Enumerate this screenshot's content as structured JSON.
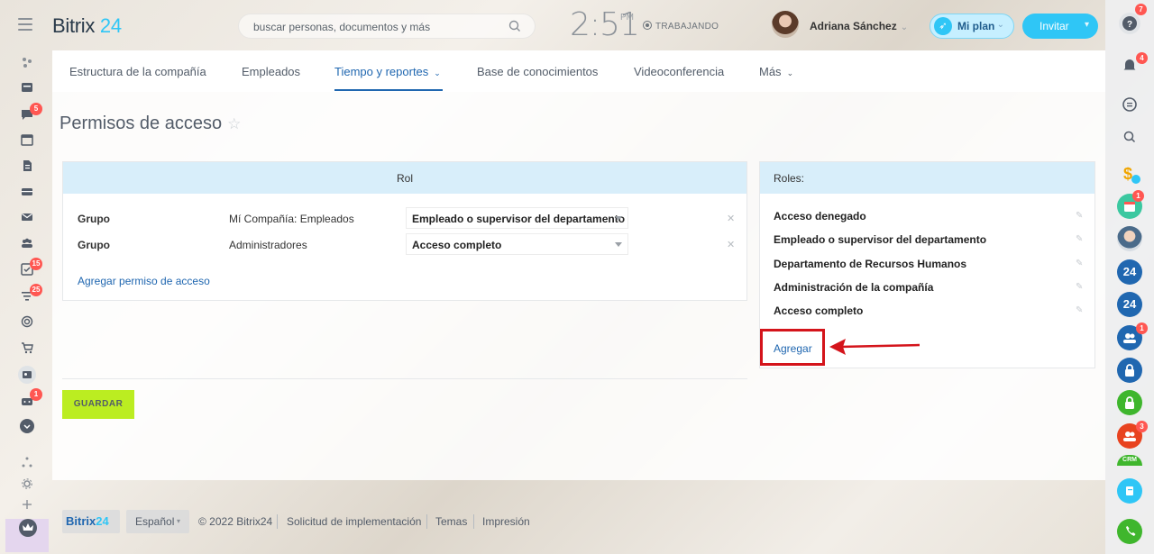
{
  "header": {
    "logo_prefix": "Bitrix",
    "logo_number": "24",
    "search_placeholder": "buscar personas, documentos y más",
    "clock": "2:51",
    "clock_period": "PM",
    "work_status": "TRABAJANDO",
    "user_name": "Adriana Sánchez",
    "plan_label": "Mi plan",
    "invite_label": "Invitar"
  },
  "nav": {
    "items": [
      {
        "label": "Estructura de la compañía"
      },
      {
        "label": "Empleados"
      },
      {
        "label": "Tiempo y reportes"
      },
      {
        "label": "Base de conocimientos"
      },
      {
        "label": "Videoconferencia"
      },
      {
        "label": "Más"
      }
    ],
    "active_index": 2
  },
  "page": {
    "title": "Permisos de acceso"
  },
  "roles_table": {
    "header": "Rol",
    "rows": [
      {
        "type": "Grupo",
        "name": "Mí Compañía: Empleados",
        "role": "Empleado o supervisor del departamento"
      },
      {
        "type": "Grupo",
        "name": "Administradores",
        "role": "Acceso completo"
      }
    ],
    "add_link": "Agregar permiso de acceso"
  },
  "roles_list": {
    "header": "Roles:",
    "items": [
      "Acceso denegado",
      "Empleado o supervisor del departamento",
      "Departamento de Recursos Humanos",
      "Administración de la compañía",
      "Acceso completo"
    ],
    "add_link": "Agregar"
  },
  "save_label": "GUARDAR",
  "left_badges": {
    "chat": "5",
    "tasks": "15",
    "filter": "25",
    "robot": "1"
  },
  "right_badges": {
    "help": "7",
    "notifications": "4",
    "calendar": "1",
    "group_a": "1",
    "group_b": "3"
  },
  "right_labels": {
    "b24_a": "24",
    "b24_b": "24",
    "crm": "CRM"
  },
  "footer": {
    "logo_prefix": "Bitrix",
    "logo_number": "24",
    "language": "Español",
    "copyright": "© 2022 Bitrix24",
    "link_impl": "Solicitud de implementación",
    "link_themes": "Temas",
    "link_print": "Impresión"
  },
  "colors": {
    "accent": "#2fc6f6",
    "link": "#2067b0",
    "save": "#bbed21",
    "highlight": "#d4141b",
    "badge": "#ff5752"
  }
}
